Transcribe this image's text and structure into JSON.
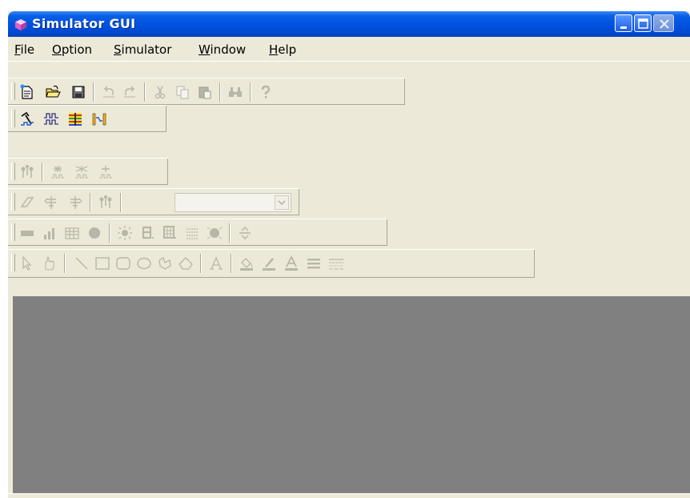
{
  "window": {
    "title": "Simulator GUI",
    "app_icon": "cube-icon",
    "controls": [
      "minimize-icon",
      "maximize-icon",
      "close-icon"
    ]
  },
  "menubar": {
    "items": [
      {
        "mnemonic": "F",
        "rest": "ile"
      },
      {
        "mnemonic": "O",
        "rest": "ption"
      },
      {
        "mnemonic": "S",
        "rest": "imulator"
      },
      {
        "mnemonic": "W",
        "rest": "indow"
      },
      {
        "mnemonic": "H",
        "rest": "elp"
      }
    ]
  },
  "toolbars": {
    "standard": [
      "new-file-icon",
      "open-folder-icon",
      "save-icon",
      "undo-icon",
      "redo-icon",
      "cut-icon",
      "copy-icon",
      "paste-icon",
      "find-icon",
      "help-icon"
    ],
    "simulation": [
      "run-simulation-icon",
      "waveform-icon",
      "signal-grid-icon",
      "probe-icon"
    ],
    "nodes": [
      "node-pins-icon",
      "node-add-icon",
      "node-remove-icon",
      "node-edit-icon"
    ],
    "edit": [
      "eraser-icon",
      "pin-left-icon",
      "pin-right-icon",
      "node-pins-icon"
    ],
    "display": [
      "bar-icon",
      "bar-chart-icon",
      "grid-icon",
      "circle-icon",
      "sun-icon",
      "digit-display-icon",
      "dot-matrix-icon",
      "lcd-icon",
      "lamp-icon",
      "spin-icon"
    ],
    "drawing": [
      "select-arrow-icon",
      "hand-icon",
      "line-icon",
      "rectangle-icon",
      "rounded-rect-icon",
      "ellipse-icon",
      "polygon-icon",
      "diamond-icon",
      "text-icon",
      "fill-color-icon",
      "line-color-icon",
      "font-color-icon",
      "line-weight-icon",
      "line-style-icon"
    ]
  },
  "colors": {
    "titlebar": "#0053e1",
    "workspace": "#808080",
    "face": "#ece9d8"
  }
}
